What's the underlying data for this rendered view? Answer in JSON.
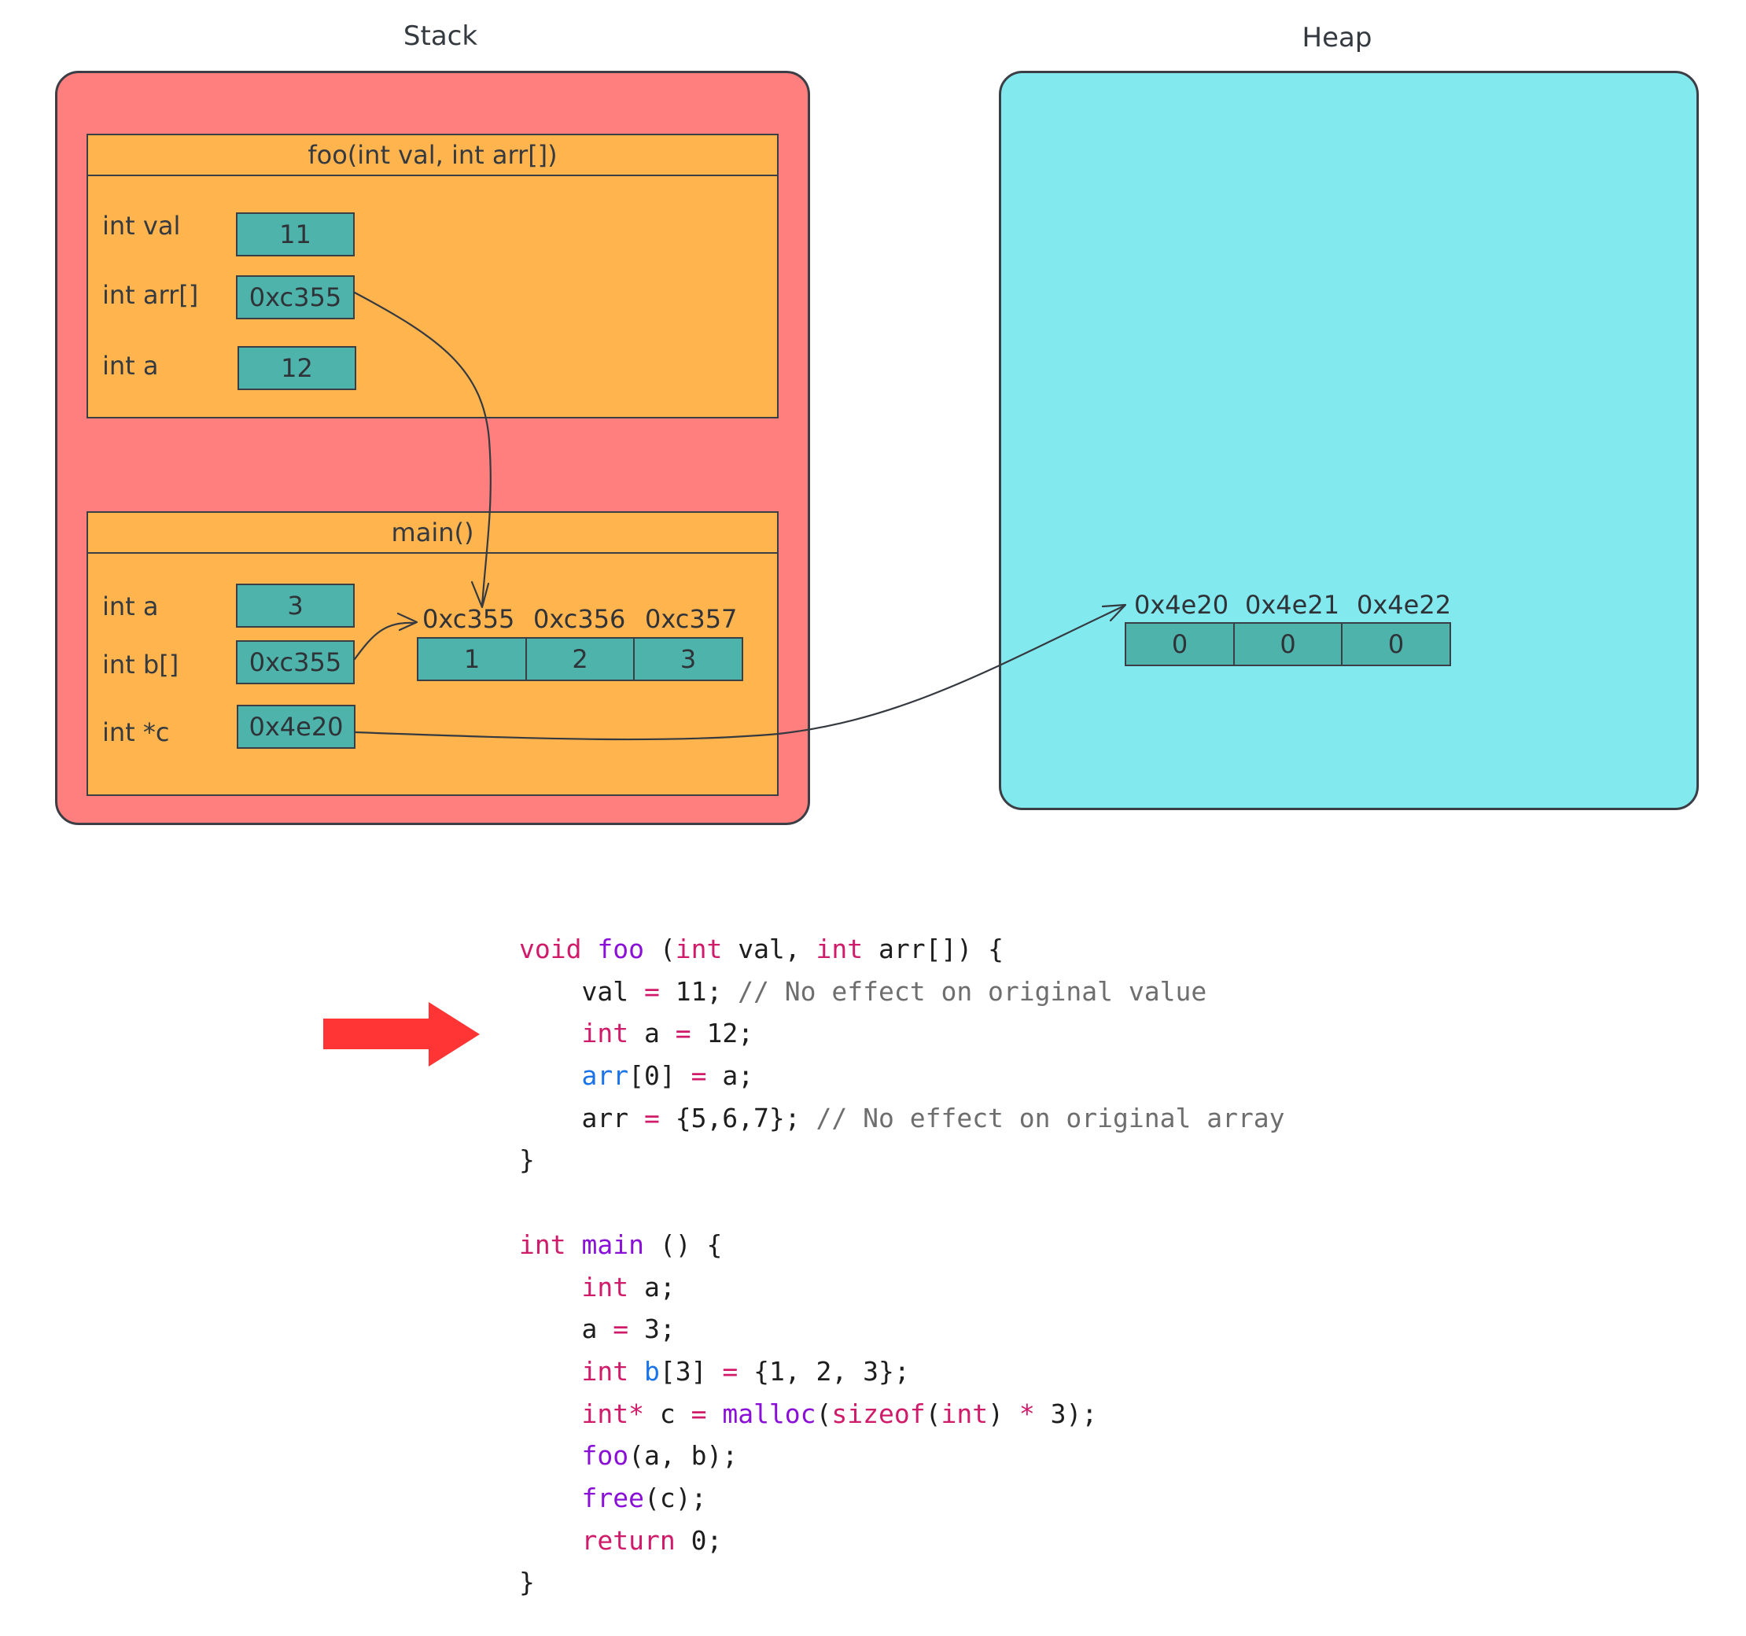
{
  "titles": {
    "stack": "Stack",
    "heap": "Heap"
  },
  "colors": {
    "stack_bg": "#ff7f7f",
    "heap_bg": "#82e9ef",
    "frame_bg": "#ffb44d",
    "cell_bg": "#4db3ab",
    "stroke": "#3b3f45",
    "pointer_arrow": "#ff3535"
  },
  "stack": {
    "frames": [
      {
        "name": "foo(int val, int arr[])",
        "vars": [
          {
            "label": "int val",
            "value": "11"
          },
          {
            "label": "int arr[]",
            "value": "0xc355"
          },
          {
            "label": "int a",
            "value": "12"
          }
        ]
      },
      {
        "name": "main()",
        "vars": [
          {
            "label": "int a",
            "value": "3"
          },
          {
            "label": "int b[]",
            "value": "0xc355"
          },
          {
            "label": "int *c",
            "value": "0x4e20"
          }
        ],
        "array": {
          "addresses": [
            "0xc355",
            "0xc356",
            "0xc357"
          ],
          "values": [
            "1",
            "2",
            "3"
          ]
        }
      }
    ]
  },
  "heap": {
    "array": {
      "addresses": [
        "0x4e20",
        "0x4e21",
        "0x4e22"
      ],
      "values": [
        "0",
        "0",
        "0"
      ]
    }
  },
  "pointers": [
    {
      "from": "foo.arr",
      "to": "main.b[0]",
      "address": "0xc355"
    },
    {
      "from": "main.b",
      "to": "main.b[0]",
      "address": "0xc355"
    },
    {
      "from": "main.c",
      "to": "heap[0]",
      "address": "0x4e20"
    }
  ],
  "current_line_indicator": {
    "icon": "right-arrow-icon",
    "points_to_line": 3
  },
  "code": {
    "lines": [
      [
        [
          "k",
          "void"
        ],
        [
          "t",
          " "
        ],
        [
          "f",
          "foo"
        ],
        [
          "t",
          " ("
        ],
        [
          "k",
          "int"
        ],
        [
          "t",
          " val, "
        ],
        [
          "k",
          "int"
        ],
        [
          "t",
          " arr[]) {"
        ]
      ],
      [
        [
          "t",
          "    val "
        ],
        [
          "o",
          "="
        ],
        [
          "t",
          " 11; "
        ],
        [
          "c",
          "// No effect on original value"
        ]
      ],
      [
        [
          "t",
          "    "
        ],
        [
          "k",
          "int"
        ],
        [
          "t",
          " a "
        ],
        [
          "o",
          "="
        ],
        [
          "t",
          " 12;"
        ]
      ],
      [
        [
          "t",
          "    "
        ],
        [
          "v",
          "arr"
        ],
        [
          "t",
          "[0] "
        ],
        [
          "o",
          "="
        ],
        [
          "t",
          " a;"
        ]
      ],
      [
        [
          "t",
          "    arr "
        ],
        [
          "o",
          "="
        ],
        [
          "t",
          " {5,6,7}; "
        ],
        [
          "c",
          "// No effect on original array"
        ]
      ],
      [
        [
          "t",
          "}"
        ]
      ],
      [
        [
          "t",
          ""
        ]
      ],
      [
        [
          "k",
          "int"
        ],
        [
          "t",
          " "
        ],
        [
          "f",
          "main"
        ],
        [
          "t",
          " () {"
        ]
      ],
      [
        [
          "t",
          "    "
        ],
        [
          "k",
          "int"
        ],
        [
          "t",
          " a;"
        ]
      ],
      [
        [
          "t",
          "    a "
        ],
        [
          "o",
          "="
        ],
        [
          "t",
          " 3;"
        ]
      ],
      [
        [
          "t",
          "    "
        ],
        [
          "k",
          "int"
        ],
        [
          "t",
          " "
        ],
        [
          "v",
          "b"
        ],
        [
          "t",
          "[3] "
        ],
        [
          "o",
          "="
        ],
        [
          "t",
          " {1, 2, 3};"
        ]
      ],
      [
        [
          "t",
          "    "
        ],
        [
          "k",
          "int*"
        ],
        [
          "t",
          " c "
        ],
        [
          "o",
          "="
        ],
        [
          "t",
          " "
        ],
        [
          "f",
          "malloc"
        ],
        [
          "t",
          "("
        ],
        [
          "k",
          "sizeof"
        ],
        [
          "t",
          "("
        ],
        [
          "k",
          "int"
        ],
        [
          "t",
          ") "
        ],
        [
          "o",
          "*"
        ],
        [
          "t",
          " 3);"
        ]
      ],
      [
        [
          "t",
          "    "
        ],
        [
          "f",
          "foo"
        ],
        [
          "t",
          "(a, b);"
        ]
      ],
      [
        [
          "t",
          "    "
        ],
        [
          "f",
          "free"
        ],
        [
          "t",
          "(c);"
        ]
      ],
      [
        [
          "t",
          "    "
        ],
        [
          "k",
          "return"
        ],
        [
          "t",
          " 0;"
        ]
      ],
      [
        [
          "t",
          "}"
        ]
      ]
    ]
  }
}
